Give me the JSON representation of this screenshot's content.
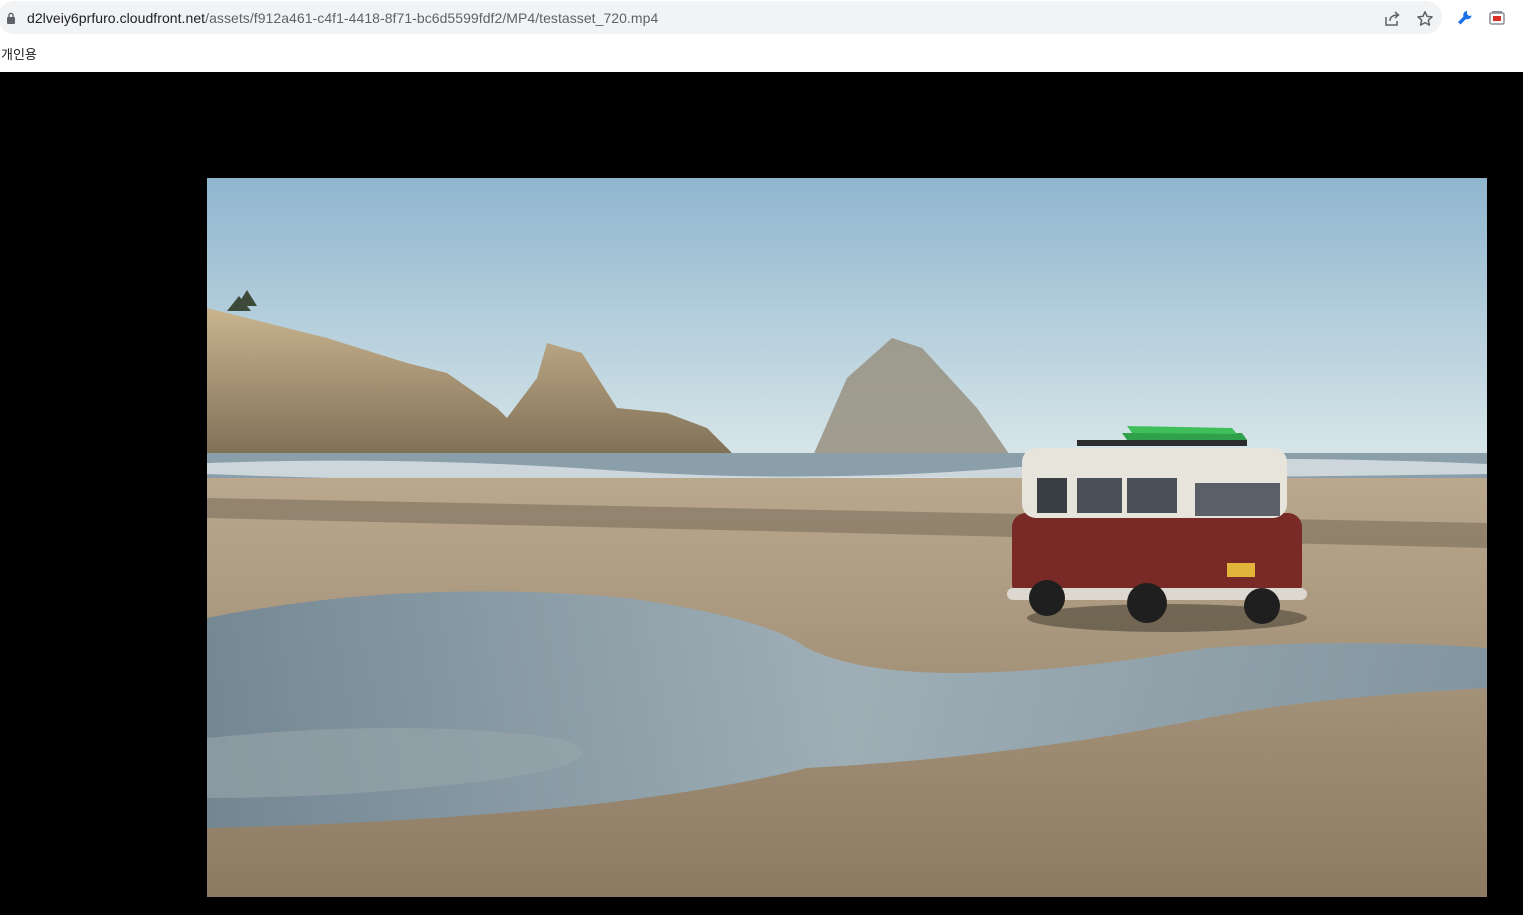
{
  "browser": {
    "address_bar": {
      "host": "d2lveiy6prfuro.cloudfront.net",
      "path": "/assets/f912a461-c4f1-4418-8f71-bc6d5599fdf2/MP4/testasset_720.mp4"
    },
    "omnibox_icons": [
      "share-icon",
      "bookmark-star-icon"
    ],
    "extension_icons": [
      "extension-wrench-icon",
      "extension-window-icon"
    ],
    "bookmarks_bar": {
      "items": [
        {
          "label": "개인용"
        }
      ]
    }
  },
  "page": {
    "background_color": "#000000",
    "video": {
      "content": "beach-scene-red-camper-van",
      "colors": {
        "sky_top": "#8fb6cf",
        "sky_bottom": "#dde9ea",
        "sea": "#8a9faa",
        "sand": "#a89478",
        "van_body": "#7a2a26",
        "van_roof": "#e7e4dc",
        "surfboard": "#2fa14a"
      }
    }
  }
}
